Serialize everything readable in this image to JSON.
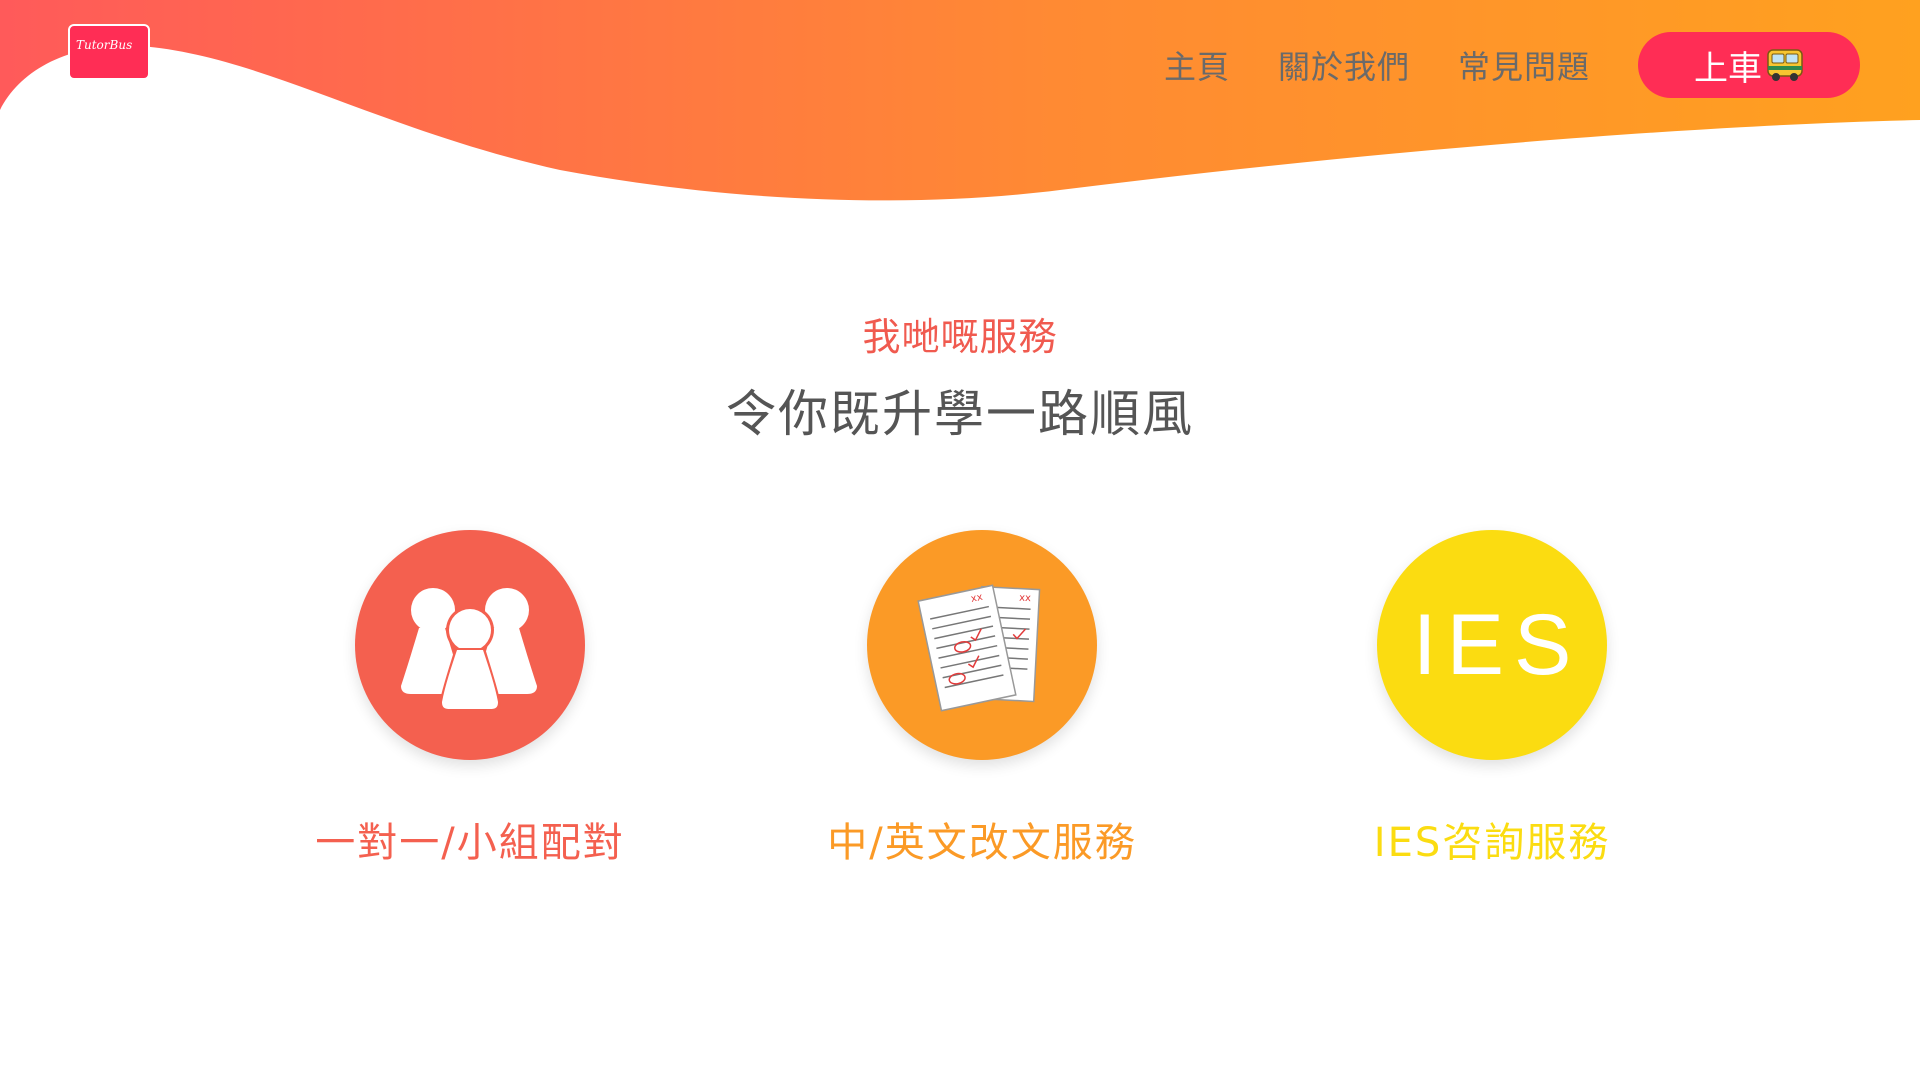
{
  "logo": {
    "text": "TutorBus"
  },
  "nav": {
    "items": [
      {
        "label": "主頁"
      },
      {
        "label": "關於我們"
      },
      {
        "label": "常見問題"
      }
    ],
    "cta_label": "上車",
    "cta_icon": "bus-icon"
  },
  "services_section": {
    "kicker": "我哋嘅服務",
    "title": "令你既升學一路順風",
    "items": [
      {
        "label": "一對一/小組配對",
        "icon": "group-people-icon",
        "color": "#f4604f"
      },
      {
        "label": "中/英文改文服務",
        "icon": "marked-papers-icon",
        "color": "#fb9a26"
      },
      {
        "label": "IES咨詢服務",
        "icon": "ies-text-icon",
        "icon_text": "IES",
        "color": "#fbdc11"
      }
    ]
  },
  "colors": {
    "header_gradient_start": "#ff5a5a",
    "header_gradient_end": "#ffa11f",
    "cta_background": "#ff2d55",
    "kicker": "#f05a4f",
    "title": "#555555"
  }
}
